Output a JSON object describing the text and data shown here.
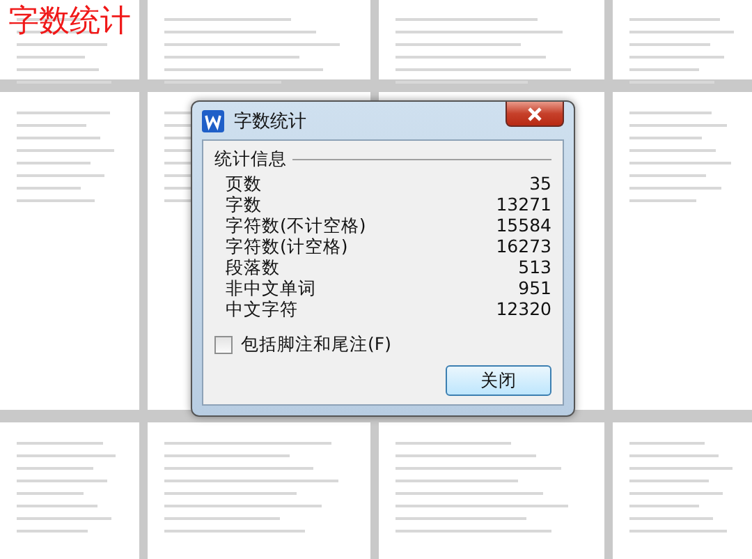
{
  "banner_title": "字数统计",
  "dialog": {
    "title": "字数统计",
    "group_label": "统计信息",
    "stats": [
      {
        "label": "页数",
        "value": "35"
      },
      {
        "label": "字数",
        "value": "13271"
      },
      {
        "label": "字符数(不计空格)",
        "value": "15584"
      },
      {
        "label": "字符数(计空格)",
        "value": "16273"
      },
      {
        "label": "段落数",
        "value": "513"
      },
      {
        "label": "非中文单词",
        "value": "951"
      },
      {
        "label": "中文字符",
        "value": "12320"
      }
    ],
    "footnote_checkbox": {
      "label": "包括脚注和尾注(F)",
      "checked": false
    },
    "close_button": "关闭"
  }
}
